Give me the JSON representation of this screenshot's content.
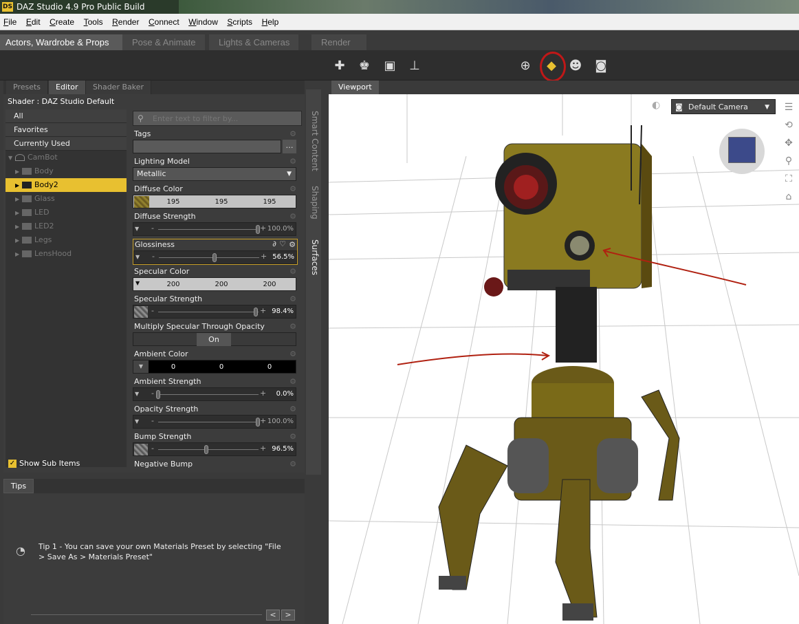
{
  "window": {
    "title": "DAZ Studio 4.9 Pro Public Build",
    "logo": "DS"
  },
  "menu": [
    "File",
    "Edit",
    "Create",
    "Tools",
    "Render",
    "Connect",
    "Window",
    "Scripts",
    "Help"
  ],
  "rooms": [
    "Actors, Wardrobe & Props",
    "Pose & Animate",
    "Lights & Cameras",
    "Render"
  ],
  "panel_tabs": [
    "Presets",
    "Editor",
    "Shader Baker"
  ],
  "shader": "Shader : DAZ Studio Default",
  "categories": [
    "All",
    "Favorites",
    "Currently Used"
  ],
  "tree": {
    "root": "CamBot",
    "items": [
      "Body",
      "Body2",
      "Glass",
      "LED",
      "LED2",
      "Legs",
      "LensHood"
    ],
    "selected": "Body2"
  },
  "filter_placeholder": "Enter text to filter by...",
  "props": {
    "tags": "Tags",
    "lighting_model_label": "Lighting Model",
    "lighting_model_value": "Metallic",
    "diffuse_color_label": "Diffuse Color",
    "diffuse_color": [
      "195",
      "195",
      "195"
    ],
    "diffuse_strength_label": "Diffuse Strength",
    "diffuse_strength": "100.0%",
    "glossiness_label": "Glossiness",
    "glossiness": "56.5%",
    "specular_color_label": "Specular Color",
    "specular_color": [
      "200",
      "200",
      "200"
    ],
    "specular_strength_label": "Specular Strength",
    "specular_strength": "98.4%",
    "multiply_label": "Multiply Specular Through Opacity",
    "multiply_value": "On",
    "ambient_color_label": "Ambient Color",
    "ambient_color": [
      "0",
      "0",
      "0"
    ],
    "ambient_strength_label": "Ambient Strength",
    "ambient_strength": "0.0%",
    "opacity_strength_label": "Opacity Strength",
    "opacity_strength": "100.0%",
    "bump_strength_label": "Bump Strength",
    "bump_strength": "96.5%",
    "negative_bump_label": "Negative Bump"
  },
  "show_sub_items": "Show Sub Items",
  "side_tabs": [
    "Smart Content",
    "Shaping",
    "Surfaces"
  ],
  "tips": {
    "tab": "Tips",
    "text": "Tip 1 - You can save your own Materials Preset by selecting \"File > Save As > Materials Preset\"",
    "prev": "<",
    "next": ">"
  },
  "viewport": {
    "tab": "Viewport",
    "camera": "Default Camera"
  },
  "icons": [
    "create-icon",
    "figure-icon",
    "import-icon",
    "transfer-icon",
    "universal-tool-icon",
    "surface-selection-icon",
    "node-selection-icon",
    "camera-icon"
  ],
  "colors": {
    "accent": "#e8c030",
    "annotation": "#c01818"
  }
}
